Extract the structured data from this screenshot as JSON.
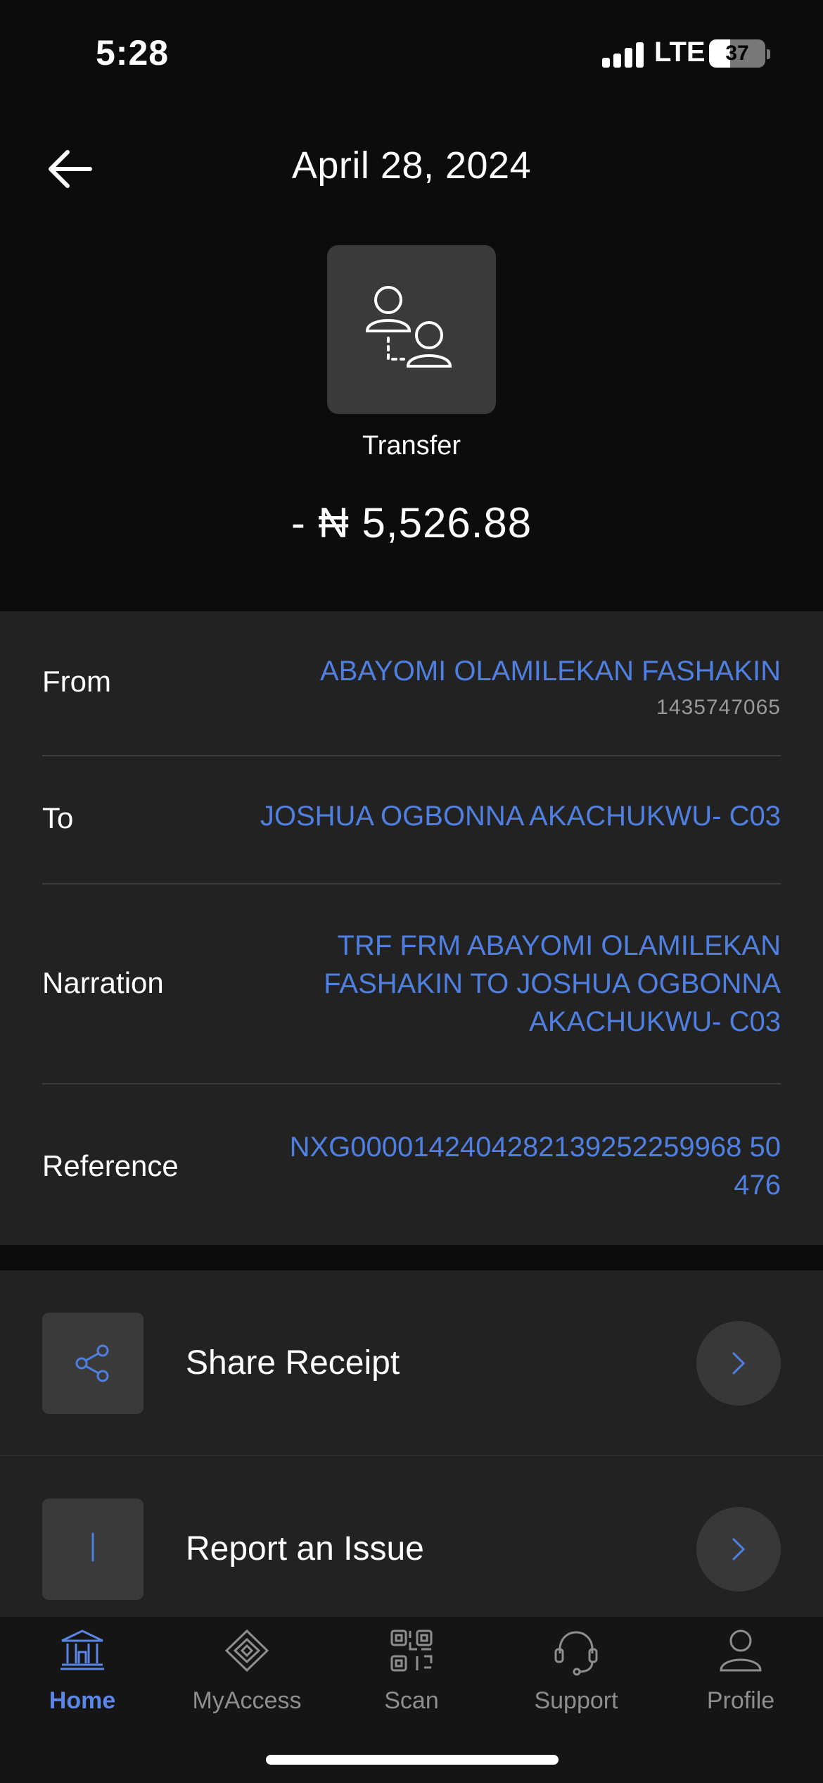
{
  "status_bar": {
    "time": "5:28",
    "network": "LTE",
    "battery_level": "37",
    "battery_fraction": 0.37
  },
  "header": {
    "title": "April 28, 2024",
    "back_icon": "arrow-left-icon"
  },
  "transaction": {
    "icon": "transfer-people-icon",
    "type_label": "Transfer",
    "amount": "- ₦ 5,526.88"
  },
  "details": {
    "from_label": "From",
    "from_name": "ABAYOMI OLAMILEKAN FASHAKIN",
    "from_account": "1435747065",
    "to_label": "To",
    "to_name": "JOSHUA OGBONNA AKACHUKWU- C03",
    "narration_label": "Narration",
    "narration_lines": [
      "TRF FRM ABAYOMI OLAMILEKAN",
      "FASHAKIN TO JOSHUA OGBONNA",
      "AKACHUKWU- C03"
    ],
    "reference_label": "Reference",
    "reference_lines": [
      "NXG0000142404282139252259968 50",
      "476"
    ]
  },
  "actions": [
    {
      "label": "Share Receipt",
      "icon": "share-icon"
    },
    {
      "label": "Report an Issue",
      "icon": "exclamation-icon"
    }
  ],
  "bottom_nav": [
    {
      "label": "Home",
      "icon": "bank-icon",
      "active": true
    },
    {
      "label": "MyAccess",
      "icon": "diamond-icon",
      "active": false
    },
    {
      "label": "Scan",
      "icon": "qr-code-icon",
      "active": false
    },
    {
      "label": "Support",
      "icon": "headset-icon",
      "active": false
    },
    {
      "label": "Profile",
      "icon": "person-icon",
      "active": false
    }
  ],
  "colors": {
    "accent": "#4f7fe0",
    "nav_active": "#5b86e5",
    "card": "#222222",
    "background": "#0c0c0c"
  }
}
